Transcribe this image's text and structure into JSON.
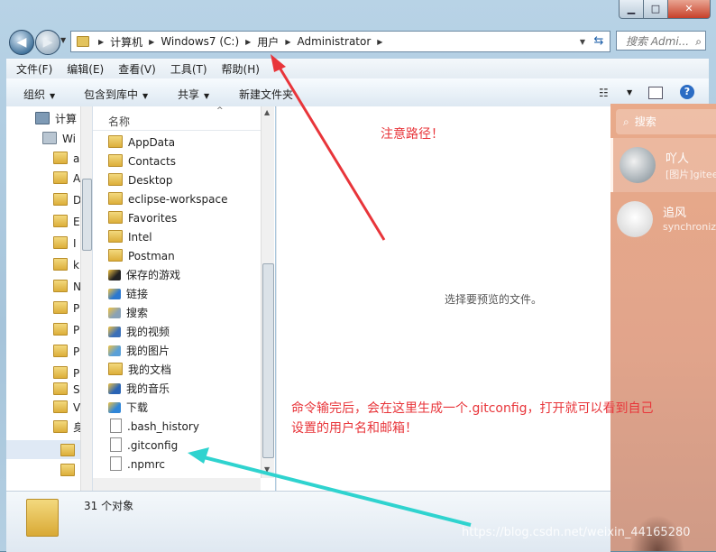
{
  "window": {
    "buttons": {
      "minimize": "▁",
      "maximize": "□",
      "close": "✕"
    }
  },
  "nav": {
    "back": "◀",
    "forward": "▶",
    "breadcrumb": [
      "计算机",
      "Windows7 (C:)",
      "用户",
      "Administrator"
    ],
    "search_placeholder": "搜索 Admi..."
  },
  "menu": [
    "文件(F)",
    "编辑(E)",
    "查看(V)",
    "工具(T)",
    "帮助(H)"
  ],
  "toolbar": {
    "organize": "组织",
    "include_library": "包含到库中",
    "share": "共享",
    "new_folder": "新建文件夹"
  },
  "nav_pane": {
    "items": [
      "计算",
      "Wi",
      "a",
      "A",
      "D",
      "E",
      "I",
      "k",
      "N",
      "P",
      "P",
      "P",
      "P",
      "S",
      "V",
      "身"
    ]
  },
  "file_list": {
    "column_header": "名称",
    "items": [
      {
        "name": "AppData",
        "icon": "folder"
      },
      {
        "name": "Contacts",
        "icon": "contacts-folder"
      },
      {
        "name": "Desktop",
        "icon": "folder"
      },
      {
        "name": "eclipse-workspace",
        "icon": "folder"
      },
      {
        "name": "Favorites",
        "icon": "favorites-folder"
      },
      {
        "name": "Intel",
        "icon": "folder"
      },
      {
        "name": "Postman",
        "icon": "folder"
      },
      {
        "name": "保存的游戏",
        "icon": "games-folder"
      },
      {
        "name": "链接",
        "icon": "links-folder"
      },
      {
        "name": "搜索",
        "icon": "search-folder"
      },
      {
        "name": "我的视频",
        "icon": "videos-folder"
      },
      {
        "name": "我的图片",
        "icon": "pictures-folder"
      },
      {
        "name": "我的文档",
        "icon": "documents-folder"
      },
      {
        "name": "我的音乐",
        "icon": "music-folder"
      },
      {
        "name": "下载",
        "icon": "downloads-folder"
      },
      {
        "name": ".bash_history",
        "icon": "file"
      },
      {
        "name": ".gitconfig",
        "icon": "file"
      },
      {
        "name": ".npmrc",
        "icon": "file"
      }
    ]
  },
  "preview": {
    "message": "选择要预览的文件。"
  },
  "status": {
    "count": "31 个对象"
  },
  "chat": {
    "search": "搜索",
    "conversations": [
      {
        "name": "吖人",
        "preview": "[图片]gitee",
        "selected": true
      },
      {
        "name": "追风",
        "preview": "synchronize",
        "selected": false
      }
    ]
  },
  "annotations": {
    "note1": "注意路径！",
    "note2_line1": "命令输完后，会在这里生成一个.gitconfig，打开就可以看到自己",
    "note2_line2": "设置的用户名和邮箱！",
    "arrow_color": "#e8353a",
    "arrow2_color": "#2fd3cf"
  },
  "watermark": "https://blog.csdn.net/weixin_44165280",
  "colors": {
    "accent": "#e8353a",
    "chat_bg": "#e1a48b",
    "folder": "#e3c35d"
  }
}
